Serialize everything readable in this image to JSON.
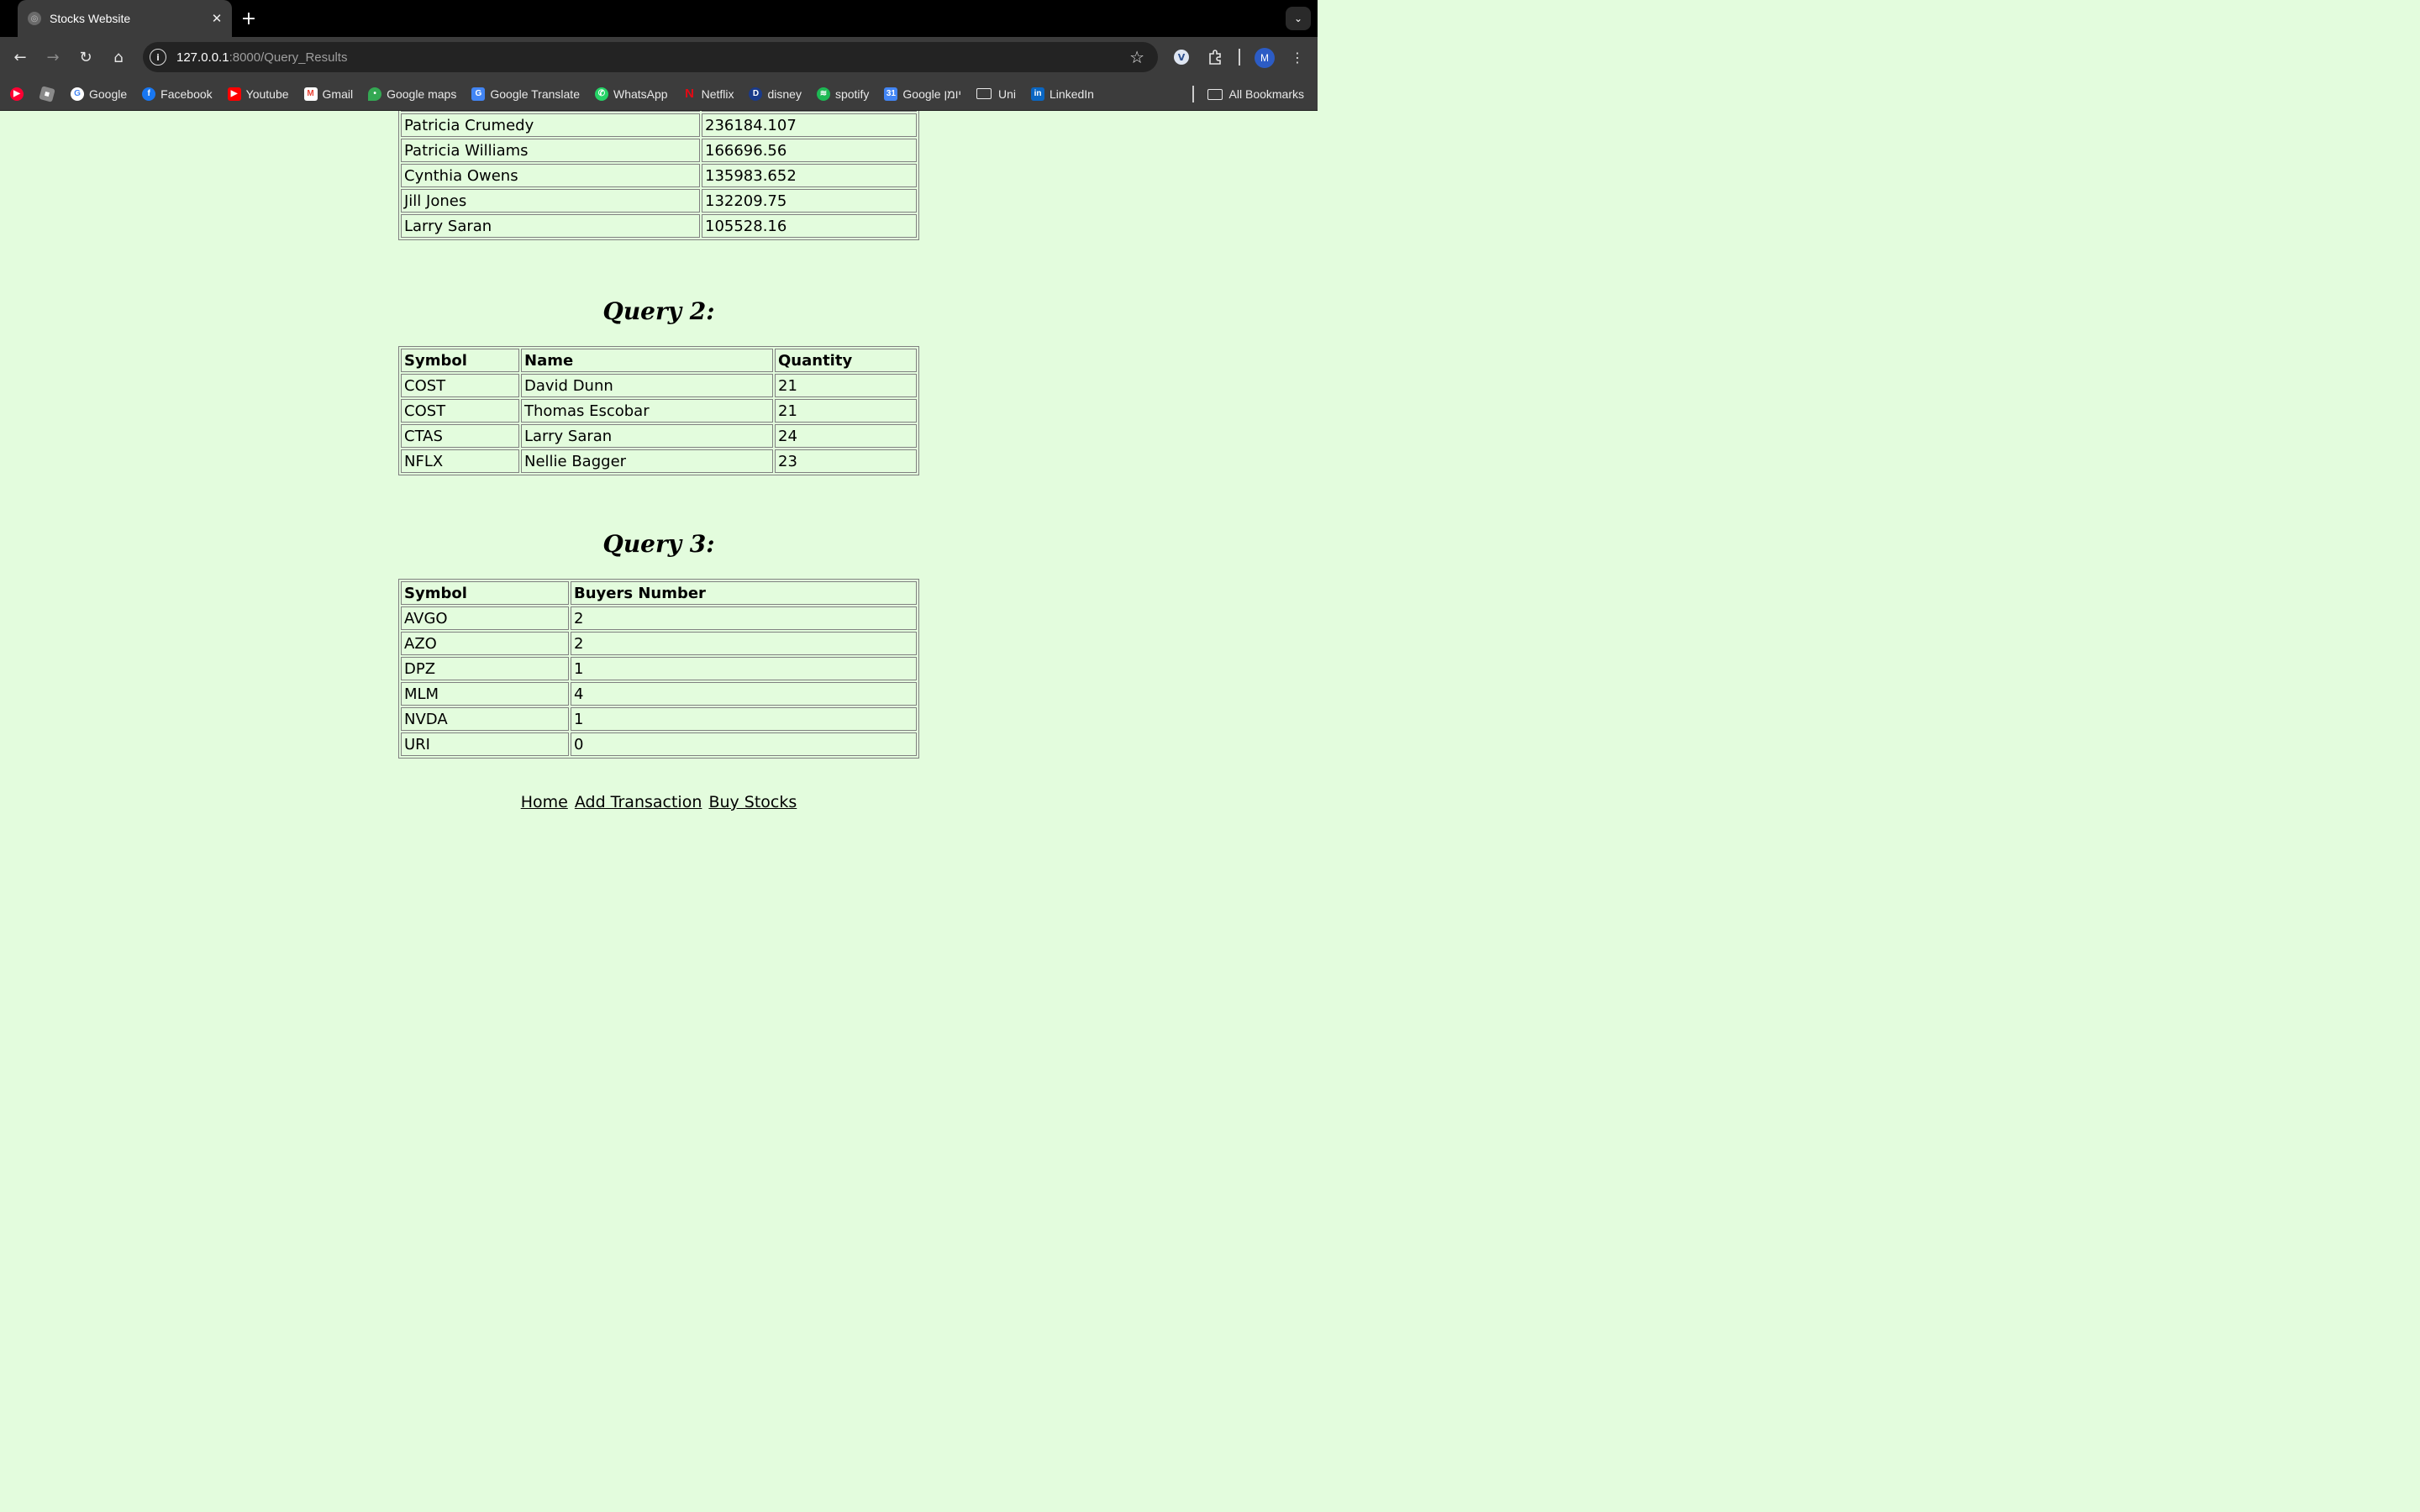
{
  "browser": {
    "tab_title": "Stocks Website",
    "url_host": "127.0.0.1",
    "url_path": ":8000/Query_Results",
    "bookmarks": [
      {
        "label": "Google",
        "icon": "google-icon",
        "color": "#4285f4"
      },
      {
        "label": "Facebook",
        "icon": "facebook-icon",
        "color": "#1877f2"
      },
      {
        "label": "Youtube",
        "icon": "youtube-icon",
        "color": "#ff0000"
      },
      {
        "label": "Gmail",
        "icon": "gmail-icon",
        "color": "#ea4335"
      },
      {
        "label": "Google maps",
        "icon": "maps-icon",
        "color": "#34a853"
      },
      {
        "label": "Google Translate",
        "icon": "translate-icon",
        "color": "#4285f4"
      },
      {
        "label": "WhatsApp",
        "icon": "whatsapp-icon",
        "color": "#25d366"
      },
      {
        "label": "Netflix",
        "icon": "netflix-icon",
        "color": "#e50914"
      },
      {
        "label": "disney",
        "icon": "disney-icon",
        "color": "#1a3a8a"
      },
      {
        "label": "spotify",
        "icon": "spotify-icon",
        "color": "#1db954"
      },
      {
        "label": "Google יומן",
        "icon": "calendar-icon",
        "color": "#4285f4"
      },
      {
        "label": "Uni",
        "icon": "folder-icon",
        "color": "#3c3c3c"
      },
      {
        "label": "LinkedIn",
        "icon": "linkedin-icon",
        "color": "#0a66c2"
      }
    ],
    "all_bookmarks": "All Bookmarks",
    "profile_initial": "M"
  },
  "query1": {
    "rows": [
      [
        "Patricia Crumedy",
        "236184.107"
      ],
      [
        "Patricia Williams",
        "166696.56"
      ],
      [
        "Cynthia Owens",
        "135983.652"
      ],
      [
        "Jill Jones",
        "132209.75"
      ],
      [
        "Larry Saran",
        "105528.16"
      ]
    ]
  },
  "query2": {
    "title": "Query 2:",
    "headers": [
      "Symbol",
      "Name",
      "Quantity"
    ],
    "rows": [
      [
        "COST",
        "David Dunn",
        "21"
      ],
      [
        "COST",
        "Thomas Escobar",
        "21"
      ],
      [
        "CTAS",
        "Larry Saran",
        "24"
      ],
      [
        "NFLX",
        "Nellie Bagger",
        "23"
      ]
    ]
  },
  "query3": {
    "title": "Query 3:",
    "headers": [
      "Symbol",
      "Buyers Number"
    ],
    "rows": [
      [
        "AVGO",
        "2"
      ],
      [
        "AZO",
        "2"
      ],
      [
        "DPZ",
        "1"
      ],
      [
        "MLM",
        "4"
      ],
      [
        "NVDA",
        "1"
      ],
      [
        "URI",
        "0"
      ]
    ]
  },
  "footer_links": [
    "Home",
    "Add Transaction",
    "Buy Stocks"
  ]
}
